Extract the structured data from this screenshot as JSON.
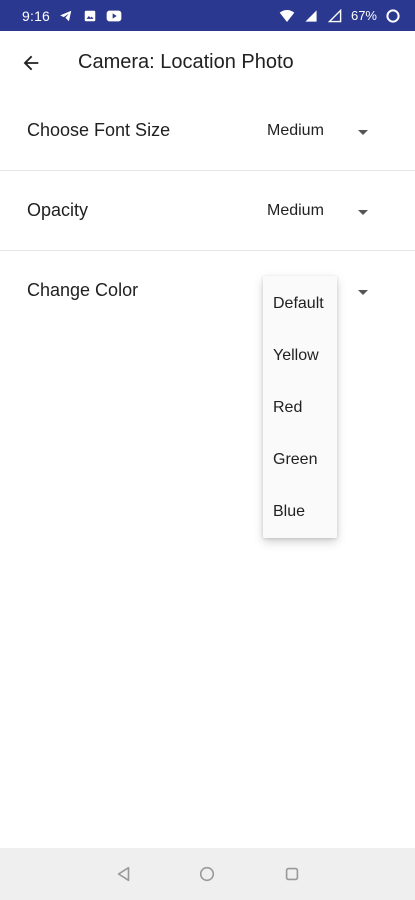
{
  "status_bar": {
    "time": "9:16",
    "battery_percent": "67%",
    "icons": [
      "telegram-icon",
      "image-icon",
      "youtube-icon",
      "wifi-icon",
      "signal-icon",
      "battery-icon"
    ]
  },
  "app_bar": {
    "title": "Camera: Location Photo",
    "back_icon": "arrow-back-icon"
  },
  "settings": [
    {
      "label": "Choose Font Size",
      "value": "Medium"
    },
    {
      "label": "Opacity",
      "value": "Medium"
    },
    {
      "label": "Change Color",
      "value": ""
    }
  ],
  "color_dropdown": {
    "options": [
      "Default",
      "Yellow",
      "Red",
      "Green",
      "Blue"
    ]
  },
  "nav_bar": {
    "icons": [
      "back-triangle-icon",
      "home-circle-icon",
      "recents-square-icon"
    ]
  },
  "colors": {
    "status_bar_bg": "#2a3890",
    "nav_bar_bg": "#efefef"
  }
}
